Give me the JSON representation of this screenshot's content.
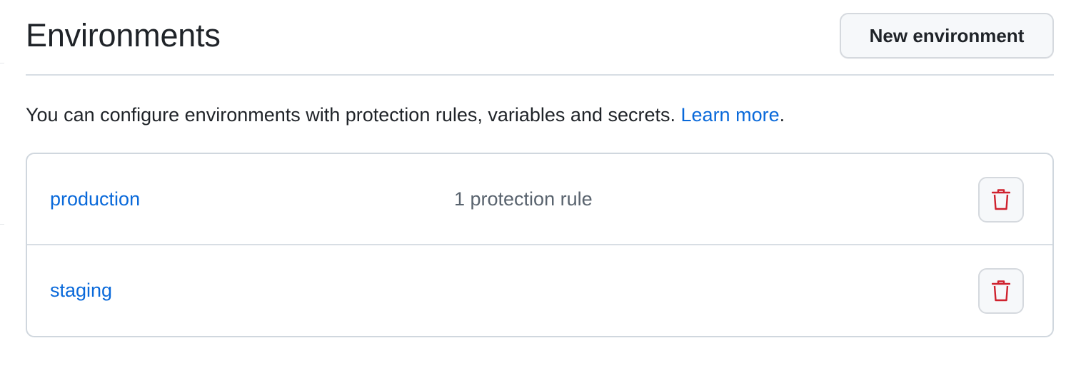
{
  "header": {
    "title": "Environments",
    "new_button_label": "New environment"
  },
  "description": {
    "text": "You can configure environments with protection rules, variables and secrets.",
    "link_label": "Learn more",
    "suffix": "."
  },
  "environments": [
    {
      "name": "production",
      "rules": "1 protection rule",
      "delete_icon": "trash-icon"
    },
    {
      "name": "staging",
      "rules": "",
      "delete_icon": "trash-icon"
    }
  ],
  "colors": {
    "link": "#0969da",
    "danger": "#cf222e",
    "muted_text": "#59636e",
    "border": "#d0d7de",
    "button_bg": "#f6f8fa"
  }
}
